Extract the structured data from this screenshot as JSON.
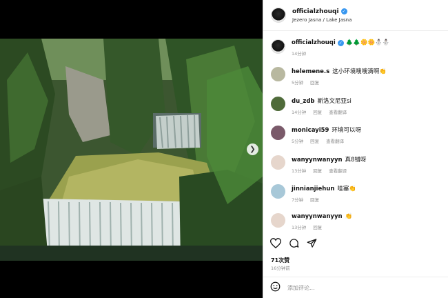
{
  "header": {
    "username": "officialzhouqi",
    "location": "Jezero Jasna / Lake Jasna"
  },
  "caption": {
    "username": "officialzhouqi",
    "emojis": "🌲🌲🌼🌼⛄⛄",
    "time": "14分钟"
  },
  "comments": [
    {
      "username": "helemene.s",
      "text": "这小环境嗖嗖滴啊👏",
      "time": "5分钟",
      "reply": "回复",
      "translate": ""
    },
    {
      "username": "du_zdb",
      "text": "斯洛文尼亚si",
      "time": "14分钟",
      "reply": "回复",
      "translate": "查看翻译"
    },
    {
      "username": "monicayi59",
      "text": "环境可以呀",
      "time": "5分钟",
      "reply": "回复",
      "translate": "查看翻译"
    },
    {
      "username": "wanyynwanyyn",
      "text": "真8错呀",
      "time": "13分钟",
      "reply": "回复",
      "translate": "查看翻译"
    },
    {
      "username": "jinnianjiehun",
      "text": "哇塞👏",
      "time": "7分钟",
      "reply": "回复",
      "translate": ""
    },
    {
      "username": "wanyynwanyyn",
      "text": "👏",
      "time": "13分钟",
      "reply": "回复",
      "translate": ""
    }
  ],
  "likes": "71次赞",
  "post_time": "16分钟前",
  "add_comment_placeholder": "添加评论...",
  "icons": {
    "like": "heart-icon",
    "comment": "comment-icon",
    "share": "share-icon",
    "emoji": "emoji-icon",
    "next": "chevron-right-icon"
  },
  "colors": {
    "verified": "#3897f0"
  }
}
